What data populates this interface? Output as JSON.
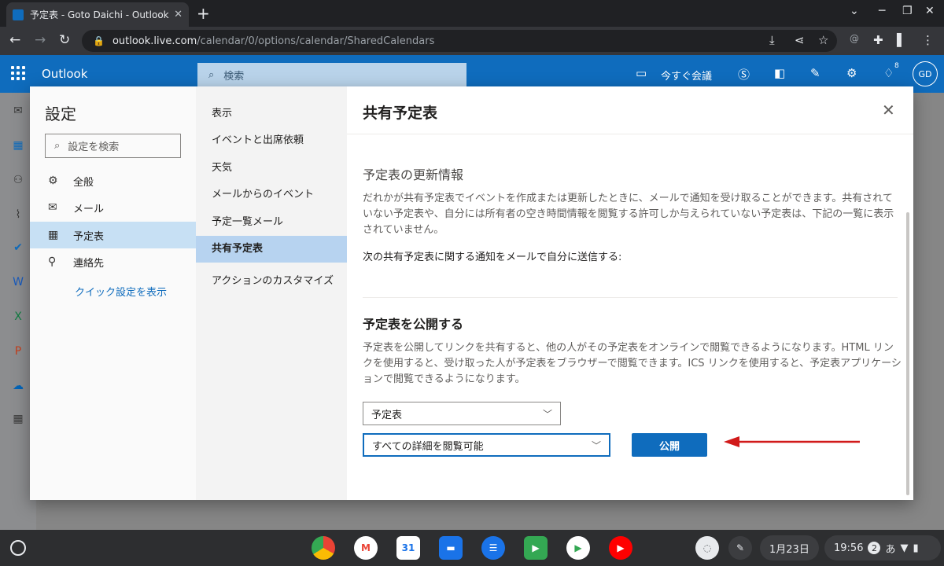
{
  "browser": {
    "tab_title": "予定表 - Goto Daichi - Outlook",
    "tab_close": "✕",
    "new_tab": "+",
    "url_host": "outlook.live.com",
    "url_path": "/calendar/0/options/calendar/SharedCalendars"
  },
  "outlook_header": {
    "brand": "Outlook",
    "search_placeholder": "検索",
    "meet_now": "今すぐ会議",
    "notification_count": "8",
    "avatar_initials": "GD"
  },
  "settings": {
    "title": "設定",
    "search_placeholder": "設定を検索",
    "categories": [
      {
        "label": "全般",
        "icon": "gear-icon"
      },
      {
        "label": "メール",
        "icon": "mail-icon"
      },
      {
        "label": "予定表",
        "icon": "calendar-icon"
      },
      {
        "label": "連絡先",
        "icon": "people-icon"
      }
    ],
    "selected_category": "予定表",
    "quick_settings_link": "クイック設定を表示",
    "subnav": [
      "表示",
      "イベントと出席依頼",
      "天気",
      "メールからのイベント",
      "予定一覧メール",
      "共有予定表",
      "アクションのカスタマイズ"
    ],
    "selected_subnav": "共有予定表"
  },
  "panel": {
    "title": "共有予定表",
    "close": "✕",
    "updates_heading": "予定表の更新情報",
    "updates_desc": "だれかが共有予定表でイベントを作成または更新したときに、メールで通知を受け取ることができます。共有されていない予定表や、自分には所有者の空き時間情報を閲覧する許可しか与えられていない予定表は、下記の一覧に表示されていません。",
    "send_label": "次の共有予定表に関する通知をメールで自分に送信する:",
    "publish_heading": "予定表を公開する",
    "publish_desc": "予定表を公開してリンクを共有すると、他の人がその予定表をオンラインで閲覧できるようになります。HTML リンクを使用すると、受け取った人が予定表をブラウザーで閲覧できます。ICS リンクを使用すると、予定表アプリケーションで閲覧できるようになります。",
    "calendar_select": "予定表",
    "permission_select": "すべての詳細を閲覧可能",
    "publish_button": "公開"
  },
  "shelf": {
    "date": "1月23日",
    "time": "19:56",
    "notif_count": "2",
    "ime": "あ"
  },
  "colors": {
    "accent": "#0f6cbd",
    "annotation_arrow": "#d11a1a"
  }
}
